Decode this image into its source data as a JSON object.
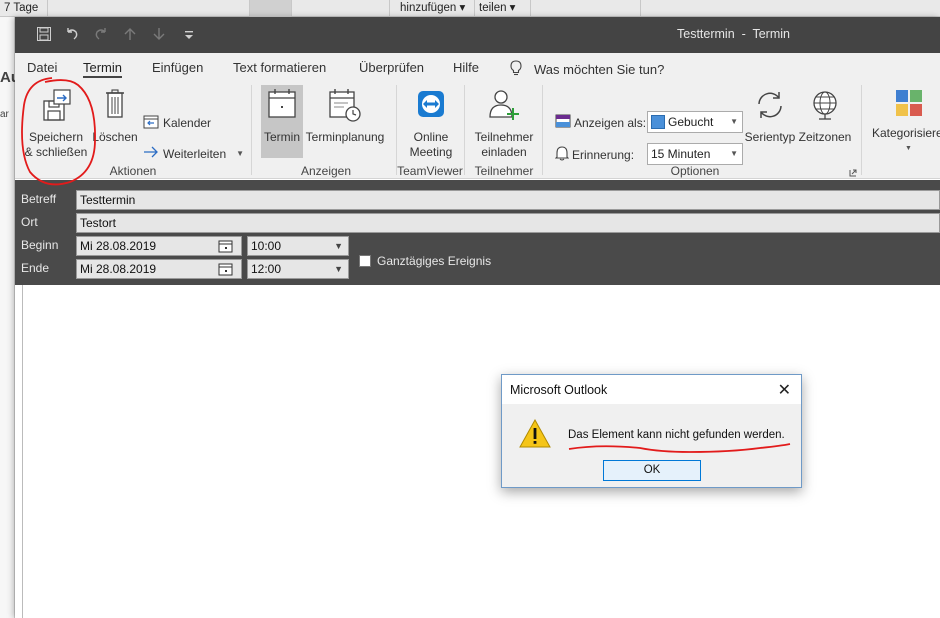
{
  "background": {
    "top_tabs": [
      "7 Tage",
      "hinzufügen ▾",
      "teilen ▾"
    ],
    "left_text_1": "Au",
    "left_text_2": "ar"
  },
  "window": {
    "title": "Testtermin  -  Termin",
    "title_bg": "#444444"
  },
  "tabs": [
    "Datei",
    "Termin",
    "Einfügen",
    "Text formatieren",
    "Überprüfen",
    "Hilfe"
  ],
  "active_tab": "Termin",
  "tell_me": "Was möchten Sie tun?",
  "ribbon": {
    "actions": {
      "save_close_line1": "Speichern",
      "save_close_line2": "& schließen",
      "delete": "Löschen",
      "calendar": "Kalender",
      "forward": "Weiterleiten",
      "label": "Aktionen"
    },
    "show": {
      "appointment": "Termin",
      "scheduling": "Terminplanung",
      "label": "Anzeigen"
    },
    "teamviewer": {
      "line1": "Online",
      "line2": "Meeting",
      "label": "TeamViewer"
    },
    "attendees": {
      "line1": "Teilnehmer",
      "line2": "einladen",
      "label": "Teilnehmer"
    },
    "options": {
      "show_as_label": "Anzeigen als:",
      "show_as_value": "Gebucht",
      "reminder_label": "Erinnerung:",
      "reminder_value": "15 Minuten",
      "recurrence": "Serientyp",
      "timezones": "Zeitzonen",
      "label": "Optionen"
    },
    "categorize": "Kategorisiere"
  },
  "form": {
    "subject_label": "Betreff",
    "subject_value": "Testtermin",
    "location_label": "Ort",
    "location_value": "Testort",
    "start_label": "Beginn",
    "start_date": "Mi 28.08.2019",
    "start_time": "10:00",
    "end_label": "Ende",
    "end_date": "Mi 28.08.2019",
    "end_time": "12:00",
    "allday_label": "Ganztägiges Ereignis"
  },
  "dialog": {
    "title": "Microsoft Outlook",
    "message": "Das Element kann nicht gefunden werden.",
    "ok": "OK"
  },
  "colors": {
    "annotation": "#e21b1b",
    "accent": "#0078d7",
    "busy": "#4a90d9"
  }
}
